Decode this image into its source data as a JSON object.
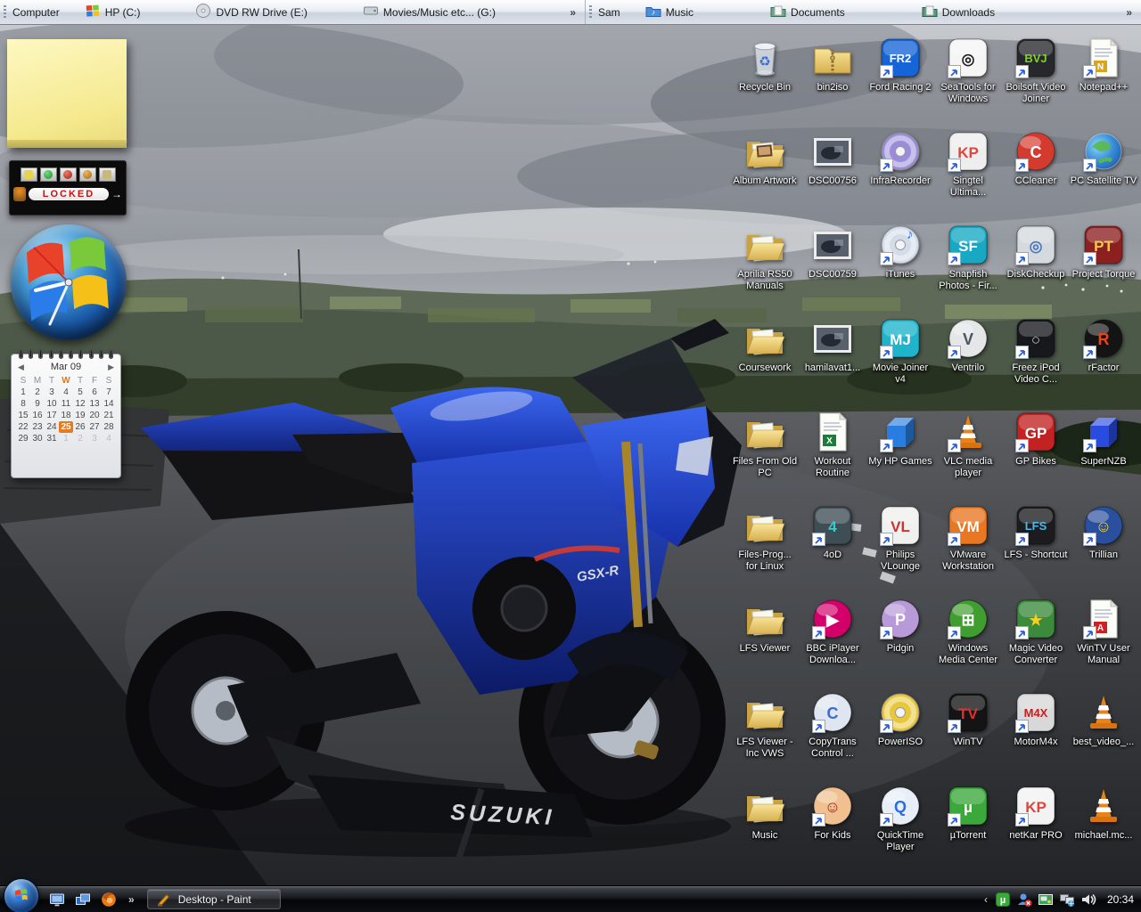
{
  "toolbars": {
    "computer": {
      "label": "Computer",
      "overflow": "»",
      "items": [
        {
          "name": "hp-c-drive",
          "label": "HP (C:)",
          "icon": "windows-flag"
        },
        {
          "name": "dvd-rw-drive-e",
          "label": "DVD RW Drive (E:)",
          "icon": "disc-drive"
        },
        {
          "name": "movies-music-g-drive",
          "label": "Movies/Music etc... (G:)",
          "icon": "hard-drive"
        }
      ]
    },
    "sam": {
      "label": "Sam",
      "overflow": "»",
      "items": [
        {
          "name": "music",
          "label": "Music",
          "icon": "music-folder"
        },
        {
          "name": "documents",
          "label": "Documents",
          "icon": "documents-folder"
        },
        {
          "name": "downloads",
          "label": "Downloads",
          "icon": "downloads-folder"
        }
      ]
    }
  },
  "gadgets": {
    "note": {
      "text": ""
    },
    "locked": {
      "status": "LOCKED",
      "arrow": "→"
    },
    "calendar": {
      "month": "Mar 09",
      "prev_arrow": "◀",
      "next_arrow": "▶",
      "day_headers": [
        "S",
        "M",
        "T",
        "W",
        "T",
        "F",
        "S"
      ],
      "highlighted_day_header_index": 3,
      "weeks": [
        [
          1,
          2,
          3,
          4,
          5,
          6,
          7
        ],
        [
          8,
          9,
          10,
          11,
          12,
          13,
          14
        ],
        [
          15,
          16,
          17,
          18,
          19,
          20,
          21
        ],
        [
          22,
          23,
          24,
          25,
          26,
          27,
          28
        ],
        [
          29,
          30,
          31,
          1,
          2,
          3,
          4
        ]
      ],
      "selected_date": 25
    }
  },
  "wallpaper": {
    "suzuki_logo": "SUZUKI",
    "fairing_logo": "GSX-R"
  },
  "desktop_icons": [
    {
      "label": "Recycle Bin",
      "name": "recycle-bin",
      "kind": "trash",
      "shortcut": false
    },
    {
      "label": "bin2iso",
      "name": "bin2iso",
      "kind": "folderzip",
      "shortcut": false
    },
    {
      "label": "Ford Racing 2",
      "name": "ford-racing-2",
      "kind": "square",
      "bg": "#1565d8",
      "fg": "#ffffff",
      "glyph": "FR2",
      "shortcut": true
    },
    {
      "label": "SeaTools for Windows",
      "name": "seatools-for-windows",
      "kind": "square",
      "bg": "#f5f5f5",
      "fg": "#222222",
      "glyph": "◎",
      "shortcut": true
    },
    {
      "label": "Boilsoft Video Joiner",
      "name": "boilsoft-video-joiner",
      "kind": "square",
      "bg": "#26282c",
      "fg": "#7ed321",
      "glyph": "BVJ",
      "shortcut": true
    },
    {
      "label": "Notepad++",
      "name": "notepad-plus-plus",
      "kind": "page",
      "accent": "#d9a520",
      "glyph": "N",
      "shortcut": true
    },
    {
      "label": "Album Artwork",
      "name": "album-artwork",
      "kind": "folderphoto",
      "shortcut": false
    },
    {
      "label": "DSC00756",
      "name": "dsc00756",
      "kind": "photo",
      "shortcut": false
    },
    {
      "label": "InfraRecorder",
      "name": "infrarecorder",
      "kind": "disc",
      "bg": "#9a8cd8",
      "fg": "#4a3a8a",
      "glyph": "",
      "shortcut": true
    },
    {
      "label": "Singtel Ultima...",
      "name": "singtel-ultima",
      "kind": "square",
      "bg": "#eeeeee",
      "fg": "#e0443a",
      "glyph": "KP",
      "shortcut": true
    },
    {
      "label": "CCleaner",
      "name": "ccleaner",
      "kind": "circle",
      "bg": "#d43b2f",
      "fg": "#ffffff",
      "glyph": "C",
      "shortcut": true
    },
    {
      "label": "PC Satellite TV",
      "name": "pc-satellite-tv",
      "kind": "globe",
      "shortcut": true
    },
    {
      "label": "Aprilia RS50 Manuals",
      "name": "aprilia-rs50-manuals",
      "kind": "folder",
      "shortcut": false
    },
    {
      "label": "DSC00759",
      "name": "dsc00759",
      "kind": "photo",
      "shortcut": false
    },
    {
      "label": "iTunes",
      "name": "itunes",
      "kind": "disc",
      "bg": "#d4dcea",
      "fg": "#2a6de0",
      "glyph": "♪",
      "shortcut": true
    },
    {
      "label": "Snapfish Photos - Fir...",
      "name": "snapfish-photos",
      "kind": "square",
      "bg": "#17a8c4",
      "fg": "#ffffff",
      "glyph": "SF",
      "shortcut": true
    },
    {
      "label": "DiskCheckup",
      "name": "diskcheckup",
      "kind": "square",
      "bg": "#d5dade",
      "fg": "#4a7ac0",
      "glyph": "◎",
      "shortcut": true
    },
    {
      "label": "Project Torque",
      "name": "project-torque",
      "kind": "square",
      "bg": "#8c2020",
      "fg": "#f2c84b",
      "glyph": "PT",
      "shortcut": true
    },
    {
      "label": "Coursework",
      "name": "coursework",
      "kind": "folder",
      "shortcut": false
    },
    {
      "label": "hamilavat1...",
      "name": "hamilavat1",
      "kind": "photo",
      "shortcut": false
    },
    {
      "label": "Movie Joiner v4",
      "name": "movie-joiner-v4",
      "kind": "square",
      "bg": "#1fb4cc",
      "fg": "#ffffff",
      "glyph": "MJ",
      "shortcut": true
    },
    {
      "label": "Ventrilo",
      "name": "ventrilo",
      "kind": "circle",
      "bg": "#e4e6e8",
      "fg": "#4a5560",
      "glyph": "V",
      "shortcut": true
    },
    {
      "label": "Freez iPod Video C...",
      "name": "freez-ipod-video-converter",
      "kind": "square",
      "bg": "#17181c",
      "fg": "#cccccc",
      "glyph": "○",
      "shortcut": true
    },
    {
      "label": "rFactor",
      "name": "rfactor",
      "kind": "circle",
      "bg": "#141414",
      "fg": "#e8431c",
      "glyph": "R",
      "shortcut": true
    },
    {
      "label": "Files From Old PC",
      "name": "files-from-old-pc",
      "kind": "folder",
      "shortcut": false
    },
    {
      "label": "Workout Routine",
      "name": "workout-routine",
      "kind": "page",
      "accent": "#1f7a3c",
      "glyph": "X",
      "shortcut": false
    },
    {
      "label": "My HP Games",
      "name": "my-hp-games",
      "kind": "cube",
      "bg": "#2a7de0",
      "shortcut": true
    },
    {
      "label": "VLC media player",
      "name": "vlc-media-player",
      "kind": "cone",
      "shortcut": true
    },
    {
      "label": "GP Bikes",
      "name": "gp-bikes",
      "kind": "square",
      "bg": "#c22222",
      "fg": "#ffffff",
      "glyph": "GP",
      "shortcut": true
    },
    {
      "label": "SuperNZB",
      "name": "supernzb",
      "kind": "cube",
      "bg": "#2a4be0",
      "shortcut": true
    },
    {
      "label": "Files-Prog... for Linux",
      "name": "files-prog-for-linux",
      "kind": "folder",
      "shortcut": false
    },
    {
      "label": "4oD",
      "name": "4od",
      "kind": "square",
      "bg": "#3e4e54",
      "fg": "#38cccc",
      "glyph": "4",
      "shortcut": true
    },
    {
      "label": "Philips VLounge",
      "name": "philips-vlounge",
      "kind": "square",
      "bg": "#f0f0ee",
      "fg": "#cc3333",
      "glyph": "VL",
      "shortcut": true
    },
    {
      "label": "VMware Workstation",
      "name": "vmware-workstation",
      "kind": "square",
      "bg": "#e87722",
      "fg": "#ffffff",
      "glyph": "VM",
      "shortcut": true
    },
    {
      "label": "LFS - Shortcut",
      "name": "lfs-shortcut",
      "kind": "square",
      "bg": "#1c1c1e",
      "fg": "#4ab8e8",
      "glyph": "LFS",
      "shortcut": true
    },
    {
      "label": "Trillian",
      "name": "trillian",
      "kind": "circle",
      "bg": "#2a4f9e",
      "fg": "#f5d020",
      "glyph": "☺",
      "shortcut": true
    },
    {
      "label": "LFS Viewer",
      "name": "lfs-viewer",
      "kind": "folder",
      "shortcut": false
    },
    {
      "label": "BBC iPlayer Downloa...",
      "name": "bbc-iplayer-downloader",
      "kind": "circle",
      "bg": "#d4006a",
      "fg": "#ffffff",
      "glyph": "▶",
      "shortcut": true
    },
    {
      "label": "Pidgin",
      "name": "pidgin",
      "kind": "circle",
      "bg": "#b89ad8",
      "fg": "#ffffff",
      "glyph": "P",
      "shortcut": true
    },
    {
      "label": "Windows Media Center",
      "name": "windows-media-center",
      "kind": "circle",
      "bg": "#3f9e2f",
      "fg": "#ffffff",
      "glyph": "⊞",
      "shortcut": true
    },
    {
      "label": "Magic Video Converter",
      "name": "magic-video-converter",
      "kind": "square",
      "bg": "#3c8a3c",
      "fg": "#f5d020",
      "glyph": "★",
      "shortcut": true
    },
    {
      "label": "WinTV User Manual",
      "name": "wintv-user-manual",
      "kind": "page",
      "accent": "#cc2222",
      "glyph": "A",
      "shortcut": true
    },
    {
      "label": "LFS Viewer - Inc VWS",
      "name": "lfs-viewer-inc-vws",
      "kind": "folder",
      "shortcut": false
    },
    {
      "label": "CopyTrans Control ...",
      "name": "copytrans-control",
      "kind": "circle",
      "bg": "#dfe6f0",
      "fg": "#3a6bd8",
      "glyph": "C",
      "shortcut": true
    },
    {
      "label": "PowerISO",
      "name": "poweriso",
      "kind": "disc",
      "bg": "#e8c83a",
      "fg": "#8a6d10",
      "glyph": "",
      "shortcut": true
    },
    {
      "label": "WinTV",
      "name": "wintv",
      "kind": "square",
      "bg": "#141414",
      "fg": "#e03030",
      "glyph": "TV",
      "shortcut": true
    },
    {
      "label": "MotorM4x",
      "name": "motorm4x",
      "kind": "square",
      "bg": "#d8d8d8",
      "fg": "#c22222",
      "glyph": "M4X",
      "shortcut": true
    },
    {
      "label": "best_video_...",
      "name": "best-video",
      "kind": "cone",
      "shortcut": false
    },
    {
      "label": "Music",
      "name": "music-folder",
      "kind": "folder",
      "shortcut": false
    },
    {
      "label": "For Kids",
      "name": "for-kids",
      "kind": "circle",
      "bg": "#f0c090",
      "fg": "#aa2222",
      "glyph": "☺",
      "shortcut": true
    },
    {
      "label": "QuickTime Player",
      "name": "quicktime-player",
      "kind": "circle",
      "bg": "#e8eef8",
      "fg": "#2a6de0",
      "glyph": "Q",
      "shortcut": true
    },
    {
      "label": "µTorrent",
      "name": "utorrent",
      "kind": "square",
      "bg": "#3aa83a",
      "fg": "#ffffff",
      "glyph": "µ",
      "shortcut": true
    },
    {
      "label": "netKar PRO",
      "name": "netkar-pro",
      "kind": "square",
      "bg": "#f2f2f2",
      "fg": "#e0443a",
      "glyph": "KP",
      "shortcut": true
    },
    {
      "label": "michael.mc...",
      "name": "michael-mc",
      "kind": "cone",
      "shortcut": false
    }
  ],
  "taskbar": {
    "quick_launch": [
      {
        "name": "show-desktop"
      },
      {
        "name": "switch-windows"
      },
      {
        "name": "firefox"
      }
    ],
    "overflow": "»",
    "task_button": {
      "label": "Desktop - Paint"
    },
    "tray": {
      "collapse": "‹",
      "icons": [
        {
          "name": "utorrent"
        },
        {
          "name": "messenger-offline"
        },
        {
          "name": "photo-viewer"
        },
        {
          "name": "network"
        },
        {
          "name": "volume"
        }
      ],
      "clock": "20:34"
    }
  }
}
